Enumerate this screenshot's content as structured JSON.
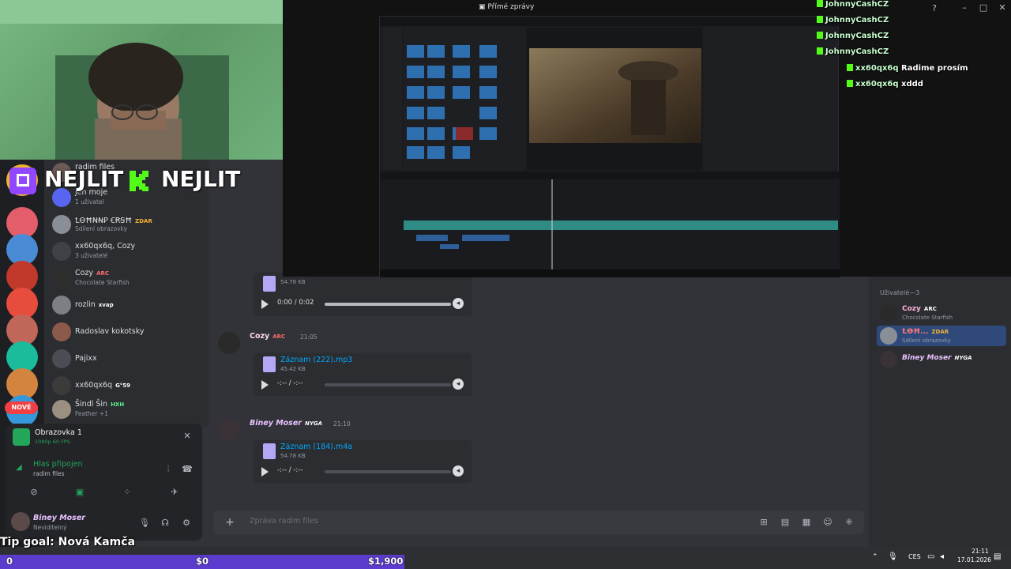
{
  "colors": {
    "discord_bg": "#313338",
    "sidebar_bg": "#2b2d31",
    "rail_bg": "#1e1f22",
    "accent_kick": "#53fc18",
    "accent_twitch": "#9146ff",
    "link": "#00a8fc",
    "goal_bar": "#5b3ccf",
    "notification_red": "#f23f43"
  },
  "window": {
    "title": "Přímé zprávy"
  },
  "overlay": {
    "platforms": [
      "twitch-icon",
      "kick-icon"
    ],
    "handle_twitch": "NEJLIT",
    "handle_kick": "NEJLIT",
    "tip_goal": "Tip goal: Nová Kamča",
    "goal_current": "$0",
    "goal_target": "$1,900",
    "goal_left": "0",
    "goal_progress": 0,
    "kick_chat": [
      {
        "user": "JohnnyCashCZ",
        "text": ""
      },
      {
        "user": "JohnnyCashCZ",
        "text": ""
      },
      {
        "user": "JohnnyCashCZ",
        "text": ""
      },
      {
        "user": "JohnnyCashCZ",
        "text": ""
      },
      {
        "user": "xx60qx6q",
        "text": "Radime prosím"
      },
      {
        "user": "xx60qx6q",
        "text": "xddd"
      }
    ]
  },
  "servers": {
    "nove_badge": "NOVÉ"
  },
  "dm_list": [
    {
      "name": "radim files",
      "sub": ""
    },
    {
      "name": "jen moje",
      "sub": "1 uživatel"
    },
    {
      "name": "ꝈꝊĦꞤꞤꝐ ꞒꞦꞨĦ",
      "tag": "ZDAR",
      "sub": "Sdílení obrazovky"
    },
    {
      "name": "xx60qx6q, Cozy",
      "sub": "3 uživatelé"
    },
    {
      "name": "Cozy",
      "tag": "ARC",
      "sub": "Chocolate Starfish"
    },
    {
      "name": "rozlin",
      "tag": "xvap",
      "sub": ""
    },
    {
      "name": "Radoslav kokotsky",
      "sub": ""
    },
    {
      "name": "Pajixx",
      "sub": ""
    },
    {
      "name": "xx60qx6q",
      "tag": "G°59",
      "sub": ""
    },
    {
      "name": "Šindl Šin",
      "tag": "HXH",
      "sub": "Feather +1"
    }
  ],
  "stream_panel": {
    "title": "Obrazovka 1",
    "sub": "1080p 60 FPS",
    "voice_status": "Hlas připojen",
    "voice_channel": "radim files"
  },
  "user": {
    "name": "Biney Moser",
    "status": "Neviditelný"
  },
  "messages": [
    {
      "author": "",
      "time": "",
      "file": {
        "name": "",
        "size": "54.78 KB",
        "time": "0:00 / 0:02",
        "progress": 1.0
      }
    },
    {
      "author": "Cozy",
      "tag": "ARC",
      "time": "21:05",
      "file": {
        "name": "Záznam (222).mp3",
        "size": "45.42 KB",
        "time": "-:-- / -:--",
        "progress": 0
      }
    },
    {
      "author": "Biney Moser",
      "tag": "NYGA",
      "time": "21:10",
      "file": {
        "name": "Záznam (184).m4a",
        "size": "54.78 KB",
        "time": "-:-- / -:--",
        "progress": 0
      }
    }
  ],
  "composer": {
    "placeholder": "Zpráva radim files"
  },
  "members": {
    "header": "Uživatelé—3",
    "list": [
      {
        "name": "Cozy",
        "tag": "ARC",
        "sub": "Chocolate Starfish"
      },
      {
        "name": "ꝈꝊĦ...",
        "tag": "ZDAR",
        "sub": "Sdílení obrazovky"
      },
      {
        "name": "Biney Moser",
        "tag": "NYGA",
        "sub": ""
      }
    ]
  },
  "taskbar": {
    "lang": "CES",
    "time": "21:11",
    "date": "17.01.2026"
  }
}
